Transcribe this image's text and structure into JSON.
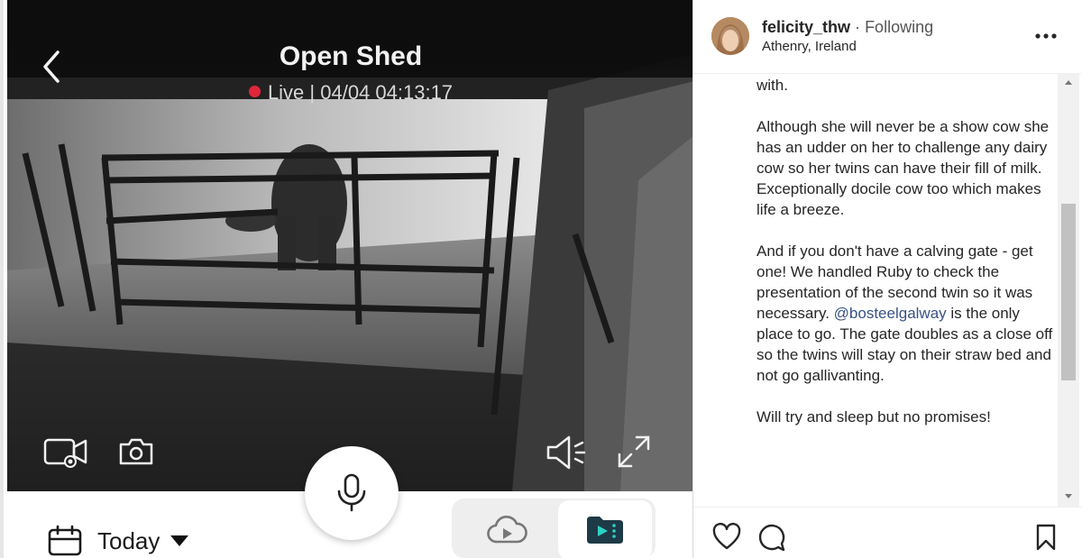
{
  "camera": {
    "title": "Open Shed",
    "live_text": "Live | 04/04 04:13:17",
    "live_dot_color": "#e0263b",
    "icons": [
      "back-arrow-icon",
      "record-video-icon",
      "camera-snapshot-icon",
      "speaker-icon",
      "fullscreen-icon",
      "microphone-icon",
      "calendar-icon",
      "cloud-playback-icon",
      "local-playback-icon"
    ],
    "date_filter": "Today"
  },
  "post": {
    "username": "felicity_thw",
    "separator": "·",
    "follow_status": "Following",
    "location": "Athenry, Ireland",
    "caption_paragraphs": [
      "with.",
      "Although she will never be a show cow she has an udder on her to challenge any dairy cow so her twins can have their fill of milk. Exceptionally docile cow too which makes life a breeze."
    ],
    "caption_p3_before": "And if you don't have a calving gate - get one! We handled Ruby to check the presentation of the second twin so it was necessary. ",
    "mention": "@bosteelgalway",
    "caption_p3_after": " is the only place to go. The gate doubles as a close off so the twins will stay on their straw bed and not go gallivanting.",
    "caption_last": "Will try and sleep but no promises!",
    "mention_color": "#385185",
    "action_icons": [
      "heart-icon",
      "comment-icon",
      "bookmark-icon"
    ]
  }
}
